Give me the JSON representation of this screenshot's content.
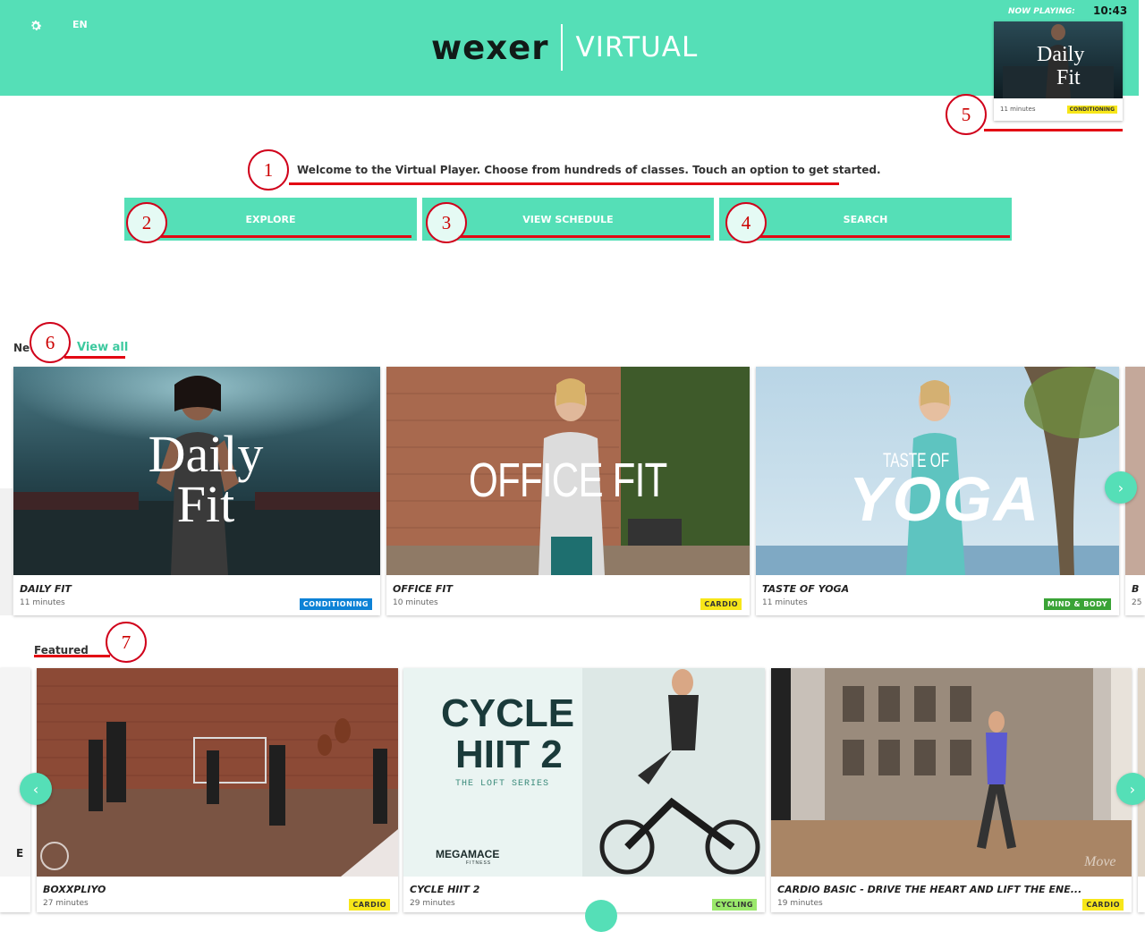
{
  "header": {
    "language": "EN",
    "brand": "wexer",
    "product": "VIRTUAL",
    "now_playing_label": "NOW PLAYING:",
    "time": "10:43",
    "now_playing": {
      "thumb_text_1": "Daily",
      "thumb_text_2": "Fit",
      "duration": "11 minutes",
      "category": "CONDITIONING"
    }
  },
  "welcome_text": "Welcome to the Virtual Player. Choose from hundreds of classes. Touch an option to get started.",
  "buttons": {
    "explore": "EXPLORE",
    "schedule": "VIEW SCHEDULE",
    "search": "SEARCH"
  },
  "annotations": [
    "1",
    "2",
    "3",
    "4",
    "5",
    "6",
    "7"
  ],
  "new_section": {
    "title": "Ne",
    "view_all": "View all",
    "cards": [
      {
        "thumb_text": "Daily Fit",
        "title": "DAILY FIT",
        "duration": "11 minutes",
        "category": "CONDITIONING"
      },
      {
        "thumb_text": "OFFICE FIT",
        "title": "OFFICE FIT",
        "duration": "10 minutes",
        "category": "CARDIO"
      },
      {
        "thumb_text_1": "TASTE OF",
        "thumb_text_2": "YOGA",
        "title": "TASTE OF YOGA",
        "duration": "11 minutes",
        "category": "MIND & BODY"
      },
      {
        "title": "B",
        "duration": "25"
      }
    ]
  },
  "featured_section": {
    "title": "Featured",
    "left_partial": "E",
    "cards": [
      {
        "title": "BOXXPLIYO",
        "duration": "27 minutes",
        "category": "CARDIO"
      },
      {
        "thumb_text_1": "CYCLE",
        "thumb_text_2": "HIIT 2",
        "thumb_text_3": "THE LOFT SERIES",
        "thumb_text_4": "MEGAMACE",
        "thumb_text_5": "FITNESS",
        "title": "CYCLE HIIT 2",
        "duration": "29 minutes",
        "category": "CYCLING"
      },
      {
        "thumb_text": "Move",
        "title": "CARDIO BASIC - DRIVE THE HEART AND LIFT THE ENE...",
        "duration": "19 minutes",
        "category": "CARDIO"
      }
    ]
  },
  "icons": {
    "settings": "gear-icon",
    "arrow_left": "‹",
    "arrow_right": "›"
  }
}
